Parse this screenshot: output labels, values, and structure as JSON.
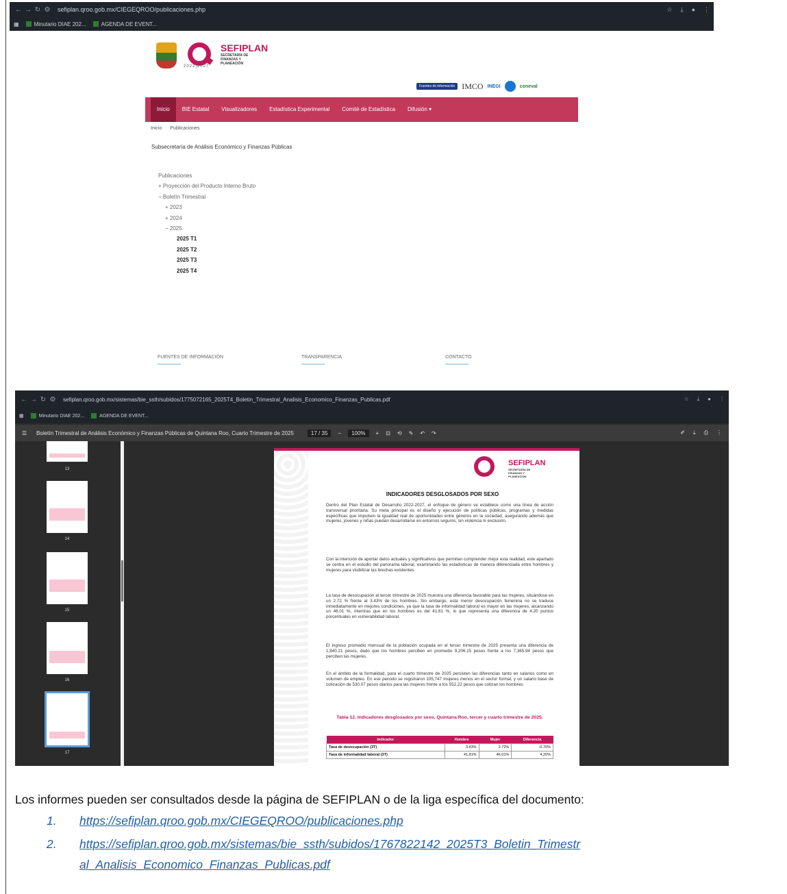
{
  "browser1": {
    "url": "sefiplan.qroo.gob.mx/CIEGEQROO/publicaciones.php",
    "bookmarks": [
      "Minutario DIAE 202...",
      "AGENDA DE EVENT..."
    ]
  },
  "site": {
    "brand": "SEFIPLAN",
    "brand_sub": "SECRETARÍA DE FINANZAS Y PLANEACIÓN",
    "years": "2022|2027",
    "partners": {
      "fuentes": "Fuentes de información",
      "imco": "IMCO",
      "inegi": "INEGI",
      "coneval": "coneval"
    },
    "nav": [
      "Inicio",
      "BIE Estatal",
      "Visualizadores",
      "Estadística Experimental",
      "Comité de Estadística",
      "Difusión ▾"
    ],
    "breadcrumb": [
      "Inicio",
      "Publicaciones"
    ],
    "subtitle": "Subsecretaría de Análisis Económico y Finanzas Públicas",
    "tree": {
      "root": "Publicaciones",
      "pib": "+ Proyección del Producto Interno Bruto",
      "boletin": "− Boletín Trimestral",
      "y2023": "+ 2023",
      "y2024": "+ 2024",
      "y2025": "− 2025",
      "items": [
        "2025 T1",
        "2025 T2",
        "2025 T3",
        "2025 T4"
      ]
    },
    "footer": [
      "FUENTES DE INFORMACIÓN",
      "TRANSPARENCIA",
      "CONTACTO"
    ]
  },
  "browser2": {
    "url": "sefiplan.qroo.gob.mx/sistemas/bie_ssth/subidos/1775072165_2025T4_Boletin_Trimestral_Analisis_Economico_Finanzas_Publicas.pdf",
    "bookmarks": [
      "Minutario DIAE 202...",
      "AGENDA DE EVENT..."
    ],
    "pdf_title": "Boletín Trimestral de Análisis Económico y Finanzas Públicas de Quintana Roo, Cuarto Trimestre de 2025",
    "page_indicator": "17 / 35",
    "zoom": "100%",
    "thumb_labels": [
      "13",
      "14",
      "15",
      "16",
      "17"
    ]
  },
  "doc": {
    "heading": "INDICADORES DESGLOSADOS POR SEXO",
    "p1": "Dentro del Plan Estatal de Desarrollo 2022-2027, el enfoque de género se establece como una línea de acción transversal prioritaria. Su meta principal es el diseño y ejecución de políticas públicas, programas y medidas específicas que impulsen la igualdad real de oportunidades entre géneros en la sociedad, asegurando además que mujeres, jóvenes y niñas puedan desarrollarse en entornos seguros, sin violencia ni exclusión.",
    "p2": "Con la intención de aportar datos actuales y significativos que permitan comprender mejor esta realidad, este apartado se centra en el estudio del panorama laboral, examinando las estadísticas de manera diferenciada entre hombres y mujeres para visibilizar las brechas existentes.",
    "p3": "La tasa de desocupación al tercer trimestre de 2025 muestra una diferencia favorable para las mujeres, situándose en un 2.72 % frente al 3.43% de los hombres. Sin embargo, esta menor desocupación femenina no se traduce inmediatamente en mejores condiciones, ya que la tasa de informalidad laboral es mayor en las mujeres, alcanzando un 46.01 %, mientras que en los hombres es del 41.81 %, lo que representa una diferencia de 4.20 puntos porcentuales en vulnerabilidad laboral.",
    "p4": "El ingreso promedio mensual de la población ocupada en el tercer trimestre de 2025 presenta una diferencia de 1,840.21 pesos, dado que los hombres perciben en promedio 9,206.15 pesos frente a los 7,365.94 pesos que perciben las mujeres.",
    "p5": "En el ámbito de la formalidad, para el cuarto trimestre de 2025 persisten las diferencias tanto en salarios como en volumen de empleo. En ese periodo se registraron 105,747 mujeres menos en el sector formal, y un salario base de cotización de 530.07 pesos diarios para las mujeres frente a los 552.22 pesos que cotizan los hombres.",
    "table_caption": "Tabla 12. Indicadores desglosados por sexo, Quintana Roo, tercer y cuarto trimestre de 2025.",
    "table_headers": [
      "Indicador",
      "Hombre",
      "Mujer",
      "Diferencia"
    ],
    "rows": [
      {
        "label": "Tasa de desocupación (3T)",
        "h": "3.43%",
        "m": "2.72%",
        "d": "-0.70%"
      },
      {
        "label": "Tasa de informalidad laboral (3T)",
        "h": "41.81%",
        "m": "46.01%",
        "d": "4.20%"
      }
    ]
  },
  "bottom": {
    "intro": "Los informes pueden ser consultados desde la página de SEFIPLAN o de la liga específica del documento:",
    "links": [
      {
        "num": "1.",
        "text": "https://sefiplan.qroo.gob.mx/CIEGEQROO/publicaciones.php"
      },
      {
        "num": "2.",
        "text1": "https://sefiplan.qroo.gob.mx/sistemas/bie_ssth/subidos/1767822142_2025T3_Boletin_Trimestr",
        "text2": "al_Analisis_Economico_Finanzas_Publicas.pdf"
      }
    ]
  },
  "colors": {
    "brand": "#c2185b",
    "nav": "#c2395c",
    "link": "#1f5fa8"
  }
}
